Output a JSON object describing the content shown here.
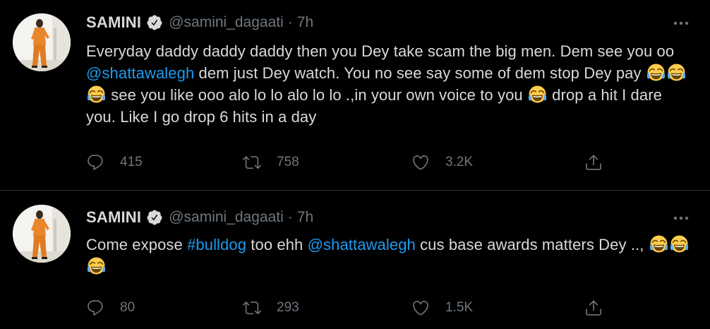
{
  "colors": {
    "background": "#000000",
    "text": "#d9d9d9",
    "muted": "#6e767d",
    "link": "#1d9bf0",
    "divider": "#2f3336",
    "verified_badge": "#d9d9d9"
  },
  "tweets": [
    {
      "author": {
        "name": "SAMINI",
        "handle": "@samini_dagaati",
        "separator": "·",
        "time": "7h",
        "verified": true
      },
      "text": {
        "p1": "Everyday daddy daddy daddy then you Dey take scam the big men. Dem see you oo ",
        "mention1": "@shattawalegh",
        "p2": " dem just Dey watch. You no see say some of dem stop Dey pay ",
        "p3": " see you like ooo alo lo lo alo lo lo .,in your own voice to you ",
        "p4": " drop a hit I dare you. Like I go drop 6 hits in a day"
      },
      "emoji": [
        "face-with-tears-of-joy",
        "face-with-tears-of-joy",
        "face-with-tears-of-joy",
        "face-with-tears-of-joy"
      ],
      "stats": {
        "replies": "415",
        "retweets": "758",
        "likes": "3.2K"
      },
      "icons": {
        "reply": "reply-icon",
        "retweet": "retweet-icon",
        "like": "like-icon",
        "share": "share-icon",
        "more": "more-icon"
      }
    },
    {
      "author": {
        "name": "SAMINI",
        "handle": "@samini_dagaati",
        "separator": "·",
        "time": "7h",
        "verified": true
      },
      "text": {
        "p1": "Come expose ",
        "hashtag1": "#bulldog",
        "p2": " too ehh ",
        "mention1": "@shattawalegh",
        "p3": " cus base awards matters Dey .., "
      },
      "emoji": [
        "face-with-tears-of-joy",
        "face-with-tears-of-joy",
        "face-with-tears-of-joy"
      ],
      "stats": {
        "replies": "80",
        "retweets": "293",
        "likes": "1.5K"
      },
      "icons": {
        "reply": "reply-icon",
        "retweet": "retweet-icon",
        "like": "like-icon",
        "share": "share-icon",
        "more": "more-icon"
      }
    }
  ]
}
